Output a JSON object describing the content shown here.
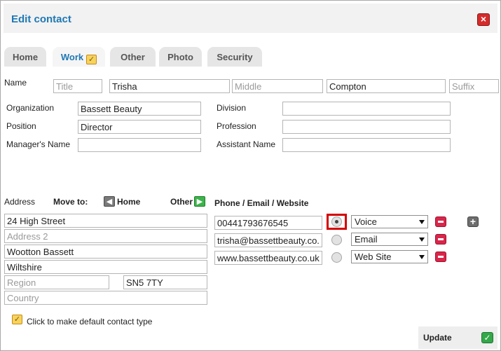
{
  "dialog": {
    "title": "Edit contact",
    "close_icon": "close-icon"
  },
  "tabs": [
    {
      "label": "Home"
    },
    {
      "label": "Work",
      "active": true
    },
    {
      "label": "Other"
    },
    {
      "label": "Photo"
    },
    {
      "label": "Security"
    }
  ],
  "name": {
    "label": "Name",
    "title": {
      "value": "",
      "placeholder": "Title"
    },
    "first": {
      "value": "Trisha",
      "placeholder": ""
    },
    "middle": {
      "value": "",
      "placeholder": "Middle"
    },
    "last": {
      "value": "Compton",
      "placeholder": ""
    },
    "suffix": {
      "value": "",
      "placeholder": "Suffix"
    }
  },
  "work": {
    "organization": {
      "label": "Organization",
      "value": "Bassett Beauty"
    },
    "division": {
      "label": "Division",
      "value": ""
    },
    "position": {
      "label": "Position",
      "value": "Director"
    },
    "profession": {
      "label": "Profession",
      "value": ""
    },
    "managers_name": {
      "label": "Manager's Name",
      "value": ""
    },
    "assistant_name": {
      "label": "Assistant Name",
      "value": ""
    }
  },
  "address": {
    "label": "Address",
    "move_to_label": "Move to:",
    "home_label": "Home",
    "other_label": "Other",
    "street": {
      "value": "24 High Street",
      "placeholder": ""
    },
    "address2": {
      "value": "",
      "placeholder": "Address 2"
    },
    "city": {
      "value": "Wootton Bassett",
      "placeholder": ""
    },
    "county": {
      "value": "Wiltshire",
      "placeholder": ""
    },
    "region": {
      "value": "",
      "placeholder": "Region"
    },
    "postcode": {
      "value": "SN5 7TY",
      "placeholder": ""
    },
    "country": {
      "value": "",
      "placeholder": "Country"
    }
  },
  "phone_email_website": {
    "header": "Phone / Email / Website",
    "rows": [
      {
        "value": "00441793676545",
        "type": "Voice",
        "default": true
      },
      {
        "value": "trisha@bassettbeauty.co.",
        "type": "Email",
        "default": false
      },
      {
        "value": "www.bassettbeauty.co.uk",
        "type": "Web Site",
        "default": false
      }
    ]
  },
  "default_contact_type": {
    "label": "Click to make default contact type"
  },
  "footer": {
    "update_label": "Update"
  },
  "colors": {
    "accent": "#1f78b4",
    "close": "#d62b2b",
    "remove": "#d9264a",
    "update": "#34a84a",
    "highlight": "#d40000"
  }
}
